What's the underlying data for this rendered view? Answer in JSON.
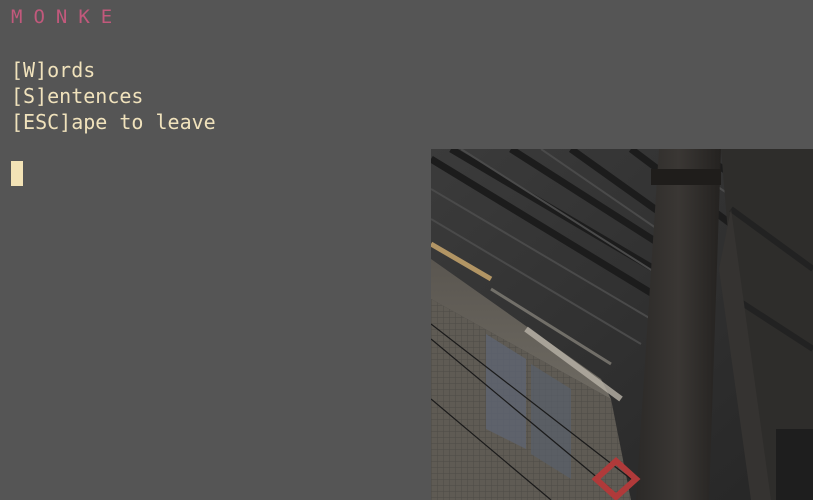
{
  "terminal": {
    "title": "MONKE",
    "menu": [
      {
        "label": "[W]ords"
      },
      {
        "label": "[S]entences"
      },
      {
        "label": "[ESC]ape to leave"
      }
    ]
  },
  "colors": {
    "background": "#555555",
    "title": "#c2597c",
    "text": "#f0e2bc",
    "cursor": "#f3e3b6"
  },
  "photo": {
    "subject": "train station platform roof with steel pillar and red diamond sign"
  }
}
